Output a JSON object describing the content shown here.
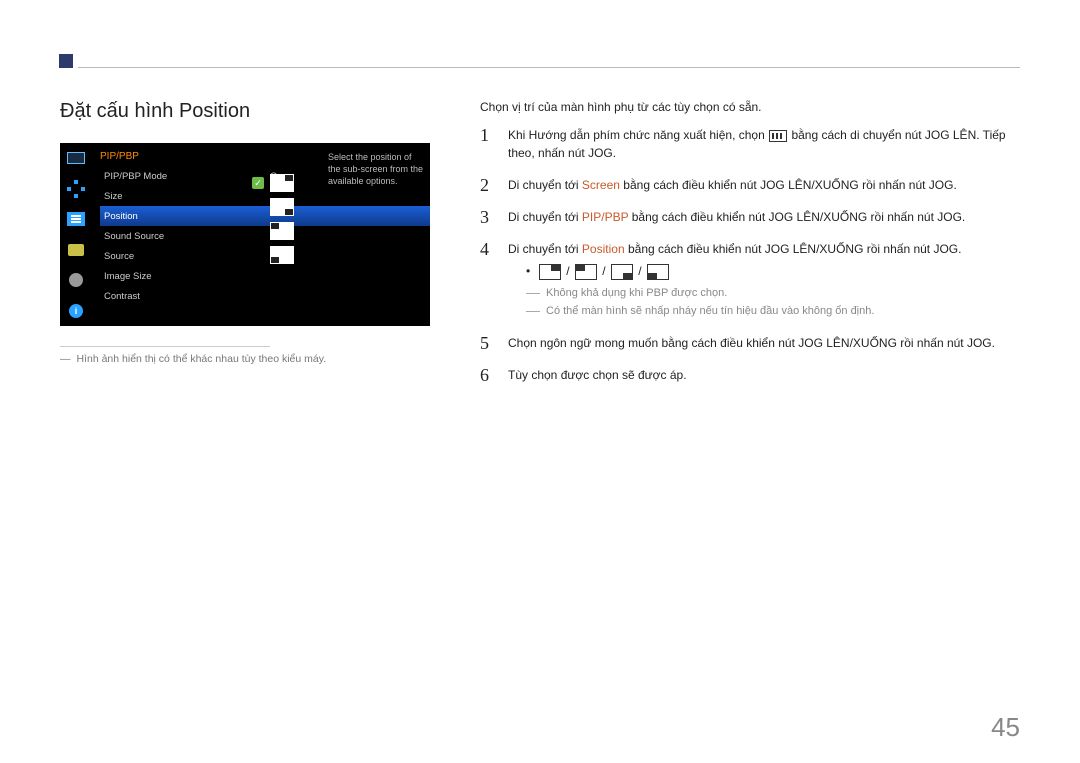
{
  "page_title": "Đặt cấu hình Position",
  "osd": {
    "header": "PIP/PBP",
    "items": [
      {
        "label": "PIP/PBP Mode",
        "value": "On",
        "selected": false
      },
      {
        "label": "Size",
        "value": "",
        "selected": false
      },
      {
        "label": "Position",
        "value": "",
        "selected": true
      },
      {
        "label": "Sound Source",
        "value": "",
        "selected": false
      },
      {
        "label": "Source",
        "value": "",
        "selected": false
      },
      {
        "label": "Image Size",
        "value": "",
        "selected": false
      },
      {
        "label": "Contrast",
        "value": "",
        "selected": false
      }
    ],
    "help": "Select the position of the sub-screen from the available options."
  },
  "caption": "Hình ảnh hiển thị có thể khác nhau tùy theo kiểu máy.",
  "intro": "Chọn vị trí của màn hình phụ từ các tùy chọn có sẵn.",
  "steps": {
    "s1a": "Khi Hướng dẫn phím chức năng xuất hiện, chọn",
    "s1b": "bằng cách di chuyển nút JOG LÊN. Tiếp theo, nhấn nút JOG.",
    "s2a": "Di chuyển tới",
    "s2k": "Screen",
    "s2b": "bằng cách điều khiển nút JOG LÊN/XUỐNG rồi nhấn nút JOG.",
    "s3a": "Di chuyển tới",
    "s3k": "PIP/PBP",
    "s3b": "bằng cách điều khiển nút JOG LÊN/XUỐNG rồi nhấn nút JOG.",
    "s4a": "Di chuyển tới",
    "s4k": "Position",
    "s4b": "bằng cách điều khiển nút JOG LÊN/XUỐNG rồi nhấn nút JOG.",
    "note1": "Không khả dụng khi PBP được chọn.",
    "note2": "Có thể màn hình sẽ nhấp nháy nếu tín hiệu đầu vào không ổn định.",
    "s5": "Chọn ngôn ngữ mong muốn bằng cách điều khiển nút JOG LÊN/XUỐNG rồi nhấn nút JOG.",
    "s6": "Tùy chọn được chọn sẽ được áp."
  },
  "nums": {
    "n1": "1",
    "n2": "2",
    "n3": "3",
    "n4": "4",
    "n5": "5",
    "n6": "6"
  },
  "slash": " / ",
  "page_number": "45"
}
